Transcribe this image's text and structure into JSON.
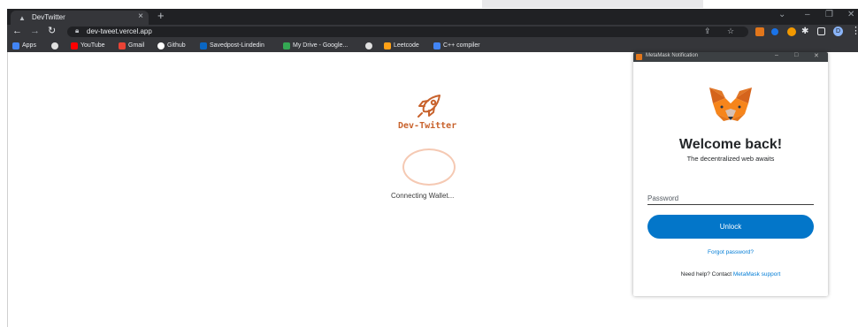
{
  "browser": {
    "tab_title": "DevTwitter",
    "tab_close": "×",
    "new_tab": "+",
    "url": "dev-tweet.vercel.app",
    "profile_initial": "D"
  },
  "bookmarks": [
    {
      "label": "Apps",
      "icon": "apps-grid-icon",
      "color": "#4285f4"
    },
    {
      "label": "",
      "icon": "chrome-icon",
      "color": "#e0e0e0"
    },
    {
      "label": "YouTube",
      "icon": "youtube-icon",
      "color": "#ff0000"
    },
    {
      "label": "Gmail",
      "icon": "gmail-icon",
      "color": "#ea4335"
    },
    {
      "label": "Github",
      "icon": "github-icon",
      "color": "#ffffff"
    },
    {
      "label": "Savedpost-Lindedin",
      "icon": "linkedin-icon",
      "color": "#0a66c2"
    },
    {
      "label": "My Drive - Google...",
      "icon": "google-drive-icon",
      "color": "#34a853"
    },
    {
      "label": "",
      "icon": "chrome-icon",
      "color": "#e0e0e0"
    },
    {
      "label": "Leetcode",
      "icon": "leetcode-icon",
      "color": "#ffa116"
    },
    {
      "label": "C++ compiler",
      "icon": "cpp-icon",
      "color": "#4285f4"
    }
  ],
  "app": {
    "name": "Dev-Twitter",
    "status": "Connecting Wallet...",
    "accent": "#c8622c"
  },
  "metamask": {
    "window_title": "MetaMask Notification",
    "welcome": "Welcome back!",
    "subtitle": "The decentralized web awaits",
    "password_label": "Password",
    "password_value": "",
    "unlock_label": "Unlock",
    "forgot_label": "Forgot password?",
    "help_text": "Need help? Contact ",
    "help_link": "MetaMask support",
    "button_color": "#0376c9",
    "link_color": "#037dd6"
  }
}
